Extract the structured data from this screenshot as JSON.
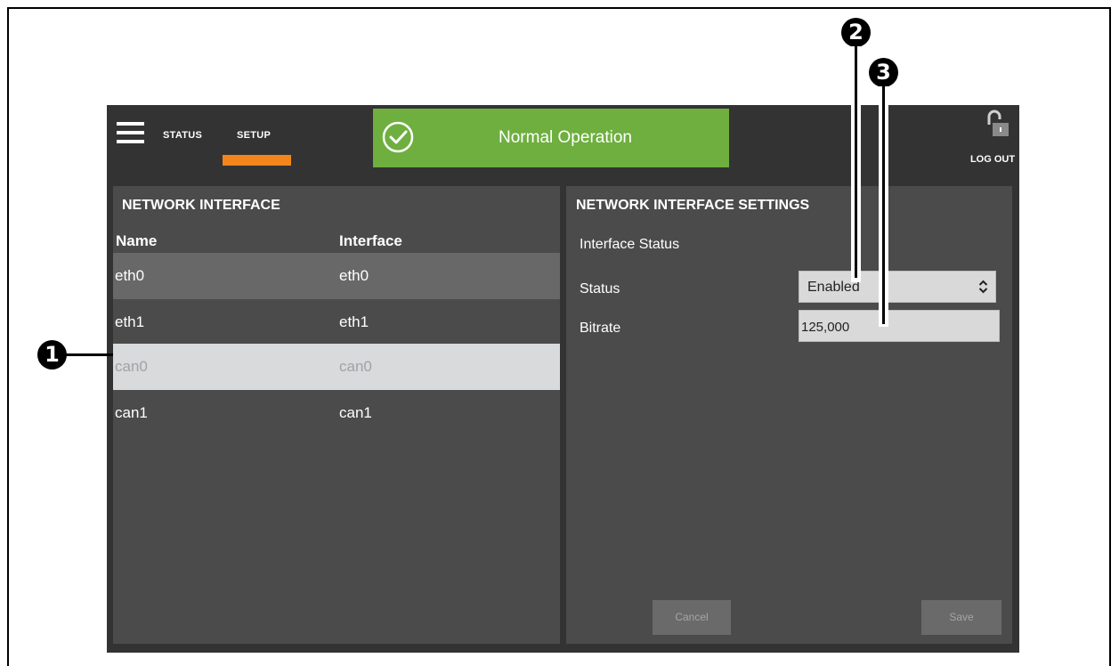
{
  "nav": {
    "status_label": "STATUS",
    "setup_label": "SETUP",
    "active_tab": "SETUP"
  },
  "banner": {
    "text": "Normal Operation",
    "color": "#6eaf3f",
    "icon": "check-circle-icon"
  },
  "logout": {
    "label": "LOG OUT",
    "icon": "unlock-icon"
  },
  "network_interface": {
    "title": "NETWORK INTERFACE",
    "columns": [
      "Name",
      "Interface"
    ],
    "rows": [
      {
        "name": "eth0",
        "interface": "eth0"
      },
      {
        "name": "eth1",
        "interface": "eth1"
      },
      {
        "name": "can0",
        "interface": "can0"
      },
      {
        "name": "can1",
        "interface": "can1"
      }
    ]
  },
  "settings": {
    "title": "NETWORK INTERFACE SETTINGS",
    "section": "Interface Status",
    "status_label": "Status",
    "status_value": "Enabled",
    "bitrate_label": "Bitrate",
    "bitrate_value": "125,000",
    "cancel_label": "Cancel",
    "save_label": "Save"
  },
  "callouts": [
    "1",
    "2",
    "3"
  ],
  "colors": {
    "accent": "#f2861c",
    "app_bg": "#333333",
    "panel_bg": "#4b4b4b",
    "selected_row": "#d8dadb"
  }
}
